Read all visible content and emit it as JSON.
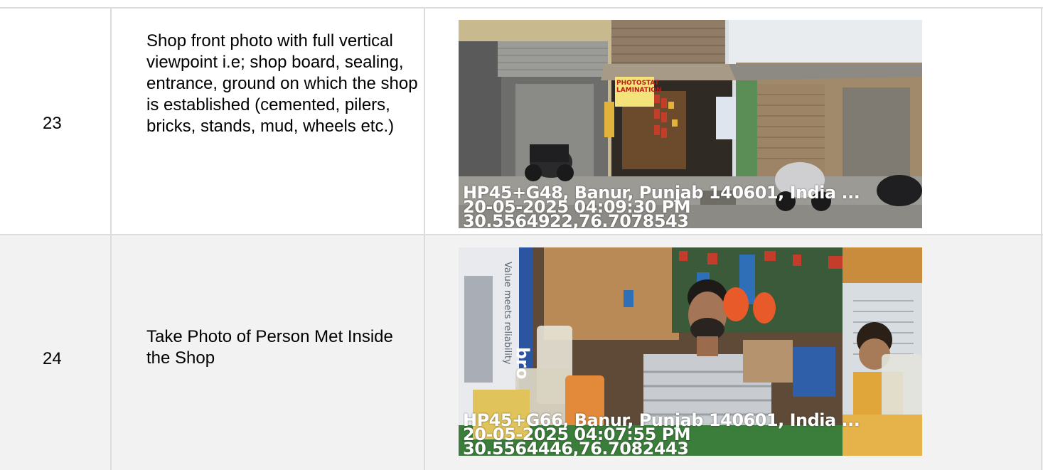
{
  "rows": [
    {
      "number": "23",
      "description": "Shop front photo with full vertical viewpoint i.e; shop board, sealing, entrance, ground on which the shop is established (cemented, pilers, bricks, stands, mud, wheels etc.)",
      "photo": {
        "address": "HP45+G48, Banur, Punjab 140601, India ...",
        "datetime": "20-05-2025 04:09:30 PM",
        "coords": "30.5564922,76.7078543",
        "signboard": "PHOTOSTAT LAMINATION"
      }
    },
    {
      "number": "24",
      "description": "Take Photo of Person Met Inside the Shop",
      "photo": {
        "address": "HP45+G66, Banur, Punjab 140601, India ...",
        "datetime": "20-05-2025 04:07:55 PM",
        "coords": "30.5564446,76.7082443",
        "box_text": "Value meets reliability",
        "box_brand": "bro"
      }
    }
  ]
}
